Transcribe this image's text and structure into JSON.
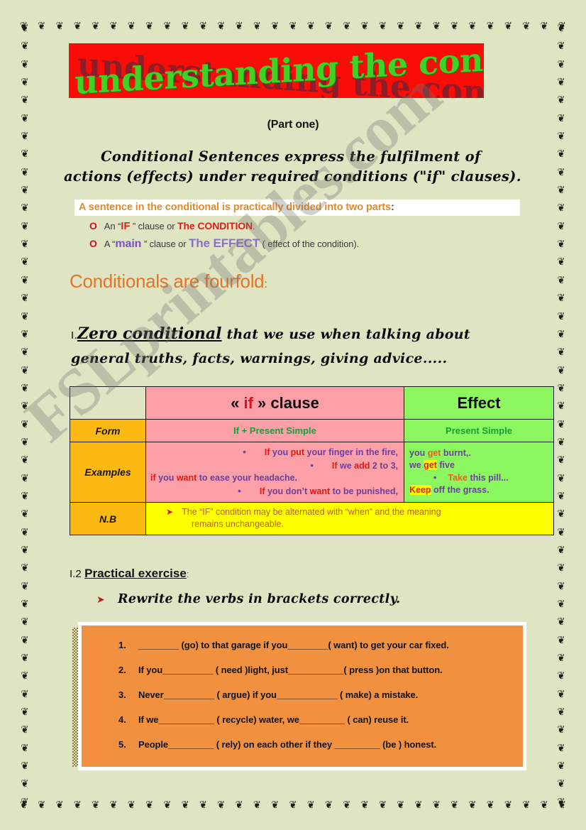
{
  "page": {
    "background_color": "#dfe5c3",
    "border_ornament": "❦",
    "watermark": "FSLprintables.com"
  },
  "banner": {
    "title": "understanding the conditionals",
    "background_color": "#fa0d07",
    "text_color": "#3fd126",
    "shadow_color": "#7a2030"
  },
  "subtitle": "(Part one)",
  "intro": "Conditional Sentences express the fulfilment of actions (effects) under required conditions (\"if\" clauses).",
  "divided_heading": {
    "text": "A sentence in the conditional is practically divided into two parts",
    "colon": ":",
    "color": "#e08a2e",
    "background_color": "#ffffff"
  },
  "bullets": [
    {
      "marker": "O",
      "parts": [
        {
          "text": "An “",
          "style": "plain"
        },
        {
          "text": "IF",
          "style": "red-bold"
        },
        {
          "text": " ” clause or ",
          "style": "plain"
        },
        {
          "text": "The CONDITION",
          "style": "red-cap"
        },
        {
          "text": ".",
          "style": "plain"
        }
      ]
    },
    {
      "marker": "O",
      "parts": [
        {
          "text": "A “",
          "style": "plain"
        },
        {
          "text": "main",
          "style": "purple-bold"
        },
        {
          "text": " ” clause or ",
          "style": "plain"
        },
        {
          "text": "The EFFECT",
          "style": "purple-cap"
        },
        {
          "text": " ( effect of the condition).",
          "style": "plain"
        }
      ]
    }
  ],
  "fourfold_heading": {
    "text": "Conditionals are fourfold",
    "colon": ":",
    "color": "#e2742a"
  },
  "zero_conditional": {
    "number": "I.",
    "keyword": "Zero conditional",
    "rest": " that we use when  talking about general truths, facts, warnings, giving advice....."
  },
  "table": {
    "headers": {
      "corner": "",
      "if_clause_pre": "« ",
      "if_clause_word": "if",
      "if_clause_post": " » clause",
      "effect": "Effect"
    },
    "colors": {
      "if_column": "#fd9fa6",
      "effect_column": "#8cf860",
      "row_label": "#fcb813",
      "nb_row": "#ffff00"
    },
    "rows": [
      {
        "label": "Form",
        "if_text": "If + Present Simple",
        "effect_text": "Present Simple",
        "text_color": "#14a03c"
      },
      {
        "label": "Examples",
        "if_lines": [
          {
            "bullet": true,
            "segments": [
              {
                "t": "If",
                "c": "r"
              },
              {
                "t": " you ",
                "c": "p"
              },
              {
                "t": "put",
                "c": "r"
              },
              {
                "t": " your finger in the fire,",
                "c": "p"
              }
            ]
          },
          {
            "bullet": true,
            "segments": [
              {
                "t": "If",
                "c": "r"
              },
              {
                "t": " we ",
                "c": "p"
              },
              {
                "t": "add",
                "c": "r"
              },
              {
                "t": " 2 to 3,",
                "c": "p"
              }
            ]
          },
          {
            "bullet": false,
            "segments": [
              {
                "t": "if",
                "c": "r"
              },
              {
                "t": " you ",
                "c": "p"
              },
              {
                "t": "want",
                "c": "r"
              },
              {
                "t": " to ease your headache.",
                "c": "p"
              }
            ]
          },
          {
            "bullet": true,
            "segments": [
              {
                "t": "If",
                "c": "r"
              },
              {
                "t": " you don’t ",
                "c": "p"
              },
              {
                "t": "want",
                "c": "r"
              },
              {
                "t": " to be punished,",
                "c": "p"
              }
            ]
          }
        ],
        "effect_lines": [
          {
            "bullet": false,
            "segments": [
              {
                "t": "you ",
                "c": "p"
              },
              {
                "t": "get",
                "c": "orange"
              },
              {
                "t": " burnt,.",
                "c": "p"
              }
            ]
          },
          {
            "bullet": false,
            "segments": [
              {
                "t": "we ",
                "c": "p"
              },
              {
                "t": "get",
                "c": "hl"
              },
              {
                "t": " five",
                "c": "p"
              }
            ]
          },
          {
            "bullet": true,
            "segments": [
              {
                "t": "Take",
                "c": "orange"
              },
              {
                "t": " this pill...",
                "c": "p"
              }
            ]
          },
          {
            "bullet": false,
            "segments": [
              {
                "t": "Keep",
                "c": "hl"
              },
              {
                "t": " off the grass.",
                "c": "p"
              }
            ]
          }
        ]
      },
      {
        "label": "N.B",
        "nb_arrow": "➤",
        "nb_line1": "The “IF” condition may be alternated with “when” and the meaning",
        "nb_line2": "remains unchangeable."
      }
    ]
  },
  "practical": {
    "number": "I.2",
    "title": "Practical exercise",
    "colon": ":",
    "instruction_arrow": "➤",
    "instruction": "Rewrite the verbs in brackets correctly."
  },
  "exercise": {
    "background_color": "#f1913f",
    "items": [
      {
        "index": "1.",
        "text": "________ (go) to that garage if you________( want) to get your car fixed."
      },
      {
        "index": "2.",
        "text": "If you__________ ( need )light, just___________( press )on that button."
      },
      {
        "index": "3.",
        "text": "Never__________ ( argue) if you____________ ( make) a mistake."
      },
      {
        "index": "4.",
        "text": "If we___________ ( recycle) water, we_________  ( can) reuse it."
      },
      {
        "index": "5.",
        "text": "People_________ ( rely) on each other if they  _________ (be ) honest."
      }
    ]
  }
}
